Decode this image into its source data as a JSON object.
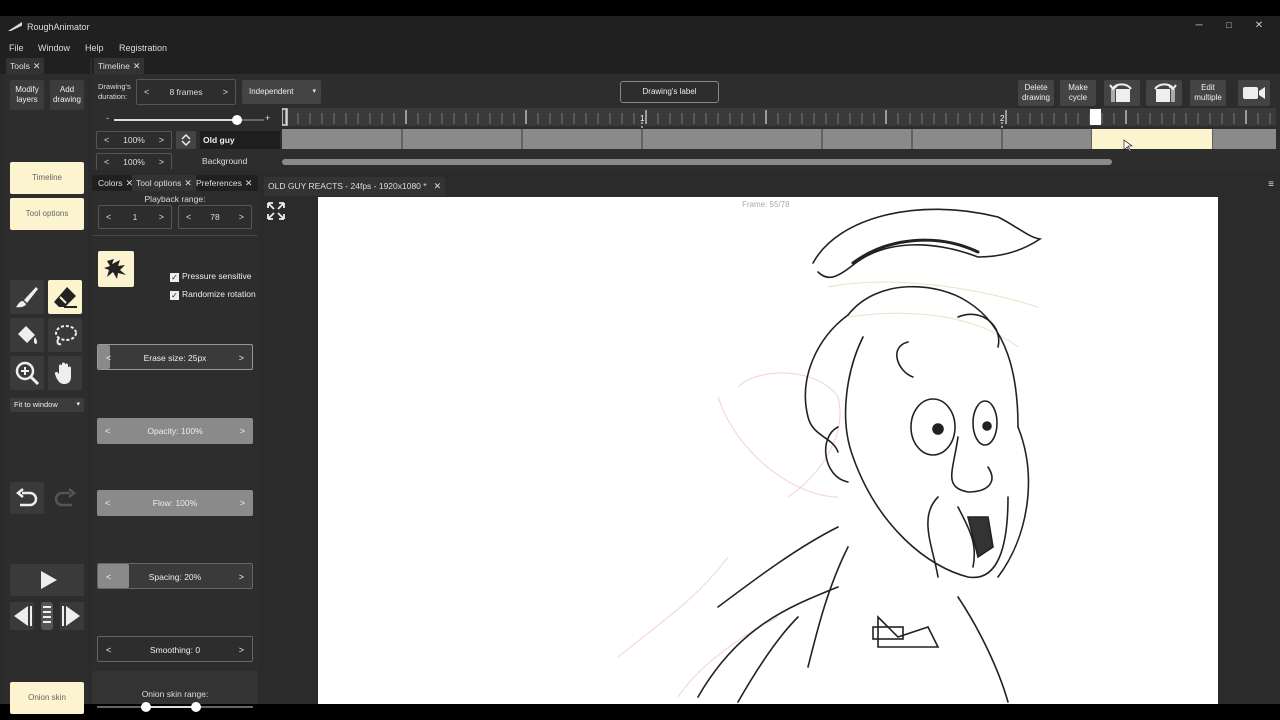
{
  "window": {
    "title": "RoughAnimator",
    "minimize": "─",
    "maximize": "□",
    "close": "✕"
  },
  "menu": {
    "file": "File",
    "window": "Window",
    "help": "Help",
    "registration": "Registration"
  },
  "tools_tab": {
    "label": "Tools",
    "close": "✕"
  },
  "tools": {
    "modify_layers": "Modify layers",
    "add_drawing": "Add drawing",
    "timeline": "Timeline",
    "tool_options": "Tool options",
    "fit": "Fit to window",
    "onion_skin": "Onion skin"
  },
  "timeline_tab": {
    "label": "Timeline",
    "close": "✕"
  },
  "timeline": {
    "duration_label": "Drawing's duration:",
    "duration_value": "8 frames",
    "mode": "Independent",
    "drawing_label": "Drawing's label",
    "delete_drawing": "Delete drawing",
    "make_cycle": "Make cycle",
    "edit_multiple": "Edit multiple",
    "zoom_minus": "-",
    "zoom_plus": "+",
    "marker_1": "1",
    "marker_2": "2",
    "layers": [
      {
        "opacity": "100%",
        "name": "Old guy"
      },
      {
        "opacity": "100%",
        "name": "Background"
      }
    ]
  },
  "side_tabs": [
    {
      "label": "Colors",
      "close": "✕"
    },
    {
      "label": "Tool options",
      "close": "✕"
    },
    {
      "label": "Preferences",
      "close": "✕"
    }
  ],
  "tool_options": {
    "playback_label": "Playback range:",
    "playback_start": "1",
    "playback_end": "78",
    "pressure": "Pressure sensitive",
    "randomize": "Randomize rotation",
    "erase_size": "Erase size: 25px",
    "opacity": "Opacity: 100%",
    "flow": "Flow: 100%",
    "spacing": "Spacing: 20%",
    "smoothing": "Smoothing: 0",
    "onion_label": "Onion skin range:"
  },
  "canvas_tab": {
    "label": "OLD GUY REACTS - 24fps - 1920x1080 *",
    "close": "✕"
  },
  "canvas": {
    "frame": "Frame: 55/78"
  },
  "colors": {
    "accent": "#fbf4cf",
    "panel": "#2d2d2d",
    "slider_fill": "#8a8a8a"
  }
}
